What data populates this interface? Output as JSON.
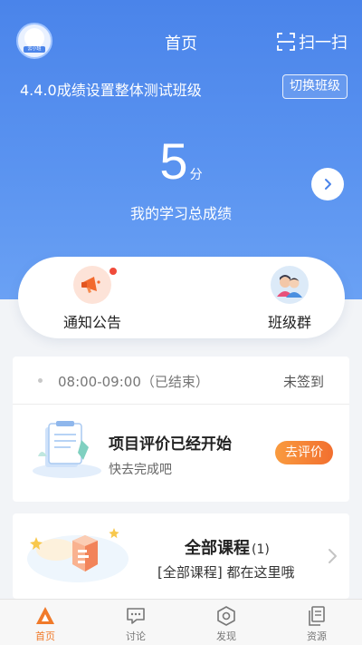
{
  "header": {
    "avatar_tag": "云小班",
    "title": "首页",
    "scan_label": "扫一扫",
    "class_name": "4.4.0成绩设置整体测试班级",
    "switch_label": "切换班级"
  },
  "score": {
    "value": "5",
    "unit": "分",
    "label": "我的学习总成绩"
  },
  "quick": {
    "notice_label": "通知公告",
    "group_label": "班级群"
  },
  "schedule": {
    "time": "08:00-09:00（已结束）",
    "status": "未签到"
  },
  "evaluation": {
    "title": "项目评价已经开始",
    "subtitle": "快去完成吧",
    "button": "去评价"
  },
  "course": {
    "title": "全部课程",
    "count": "(1)",
    "subtitle": "[全部课程] 都在这里哦"
  },
  "tabs": [
    {
      "label": "首页",
      "icon": "home-icon",
      "active": true
    },
    {
      "label": "讨论",
      "icon": "discussion-icon",
      "active": false
    },
    {
      "label": "发现",
      "icon": "discover-icon",
      "active": false
    },
    {
      "label": "资源",
      "icon": "resource-icon",
      "active": false
    }
  ],
  "colors": {
    "brand_blue": "#4a84ea",
    "accent_orange": "#f07a2a",
    "notification_dot": "#f04b3a"
  }
}
